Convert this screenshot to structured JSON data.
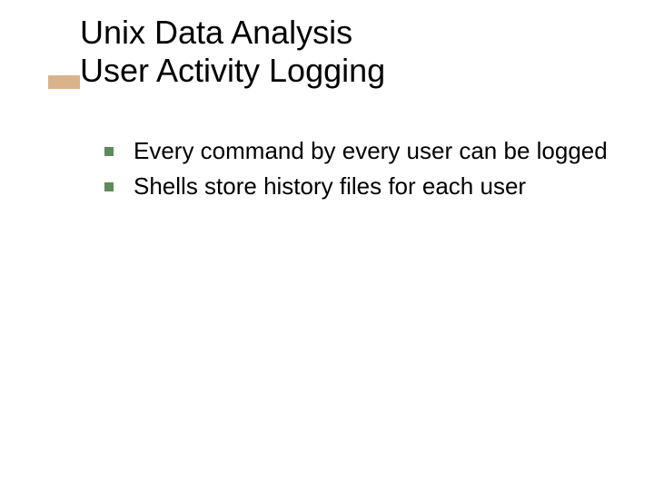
{
  "title": {
    "line1": "Unix Data Analysis",
    "line2": "User Activity Logging"
  },
  "bullets": [
    {
      "text": "Every command by every user can be logged"
    },
    {
      "text": "Shells store history files for each user"
    }
  ],
  "colors": {
    "accent_bar": "#d9b38c",
    "bullet_fill": "#5b8c5a"
  }
}
